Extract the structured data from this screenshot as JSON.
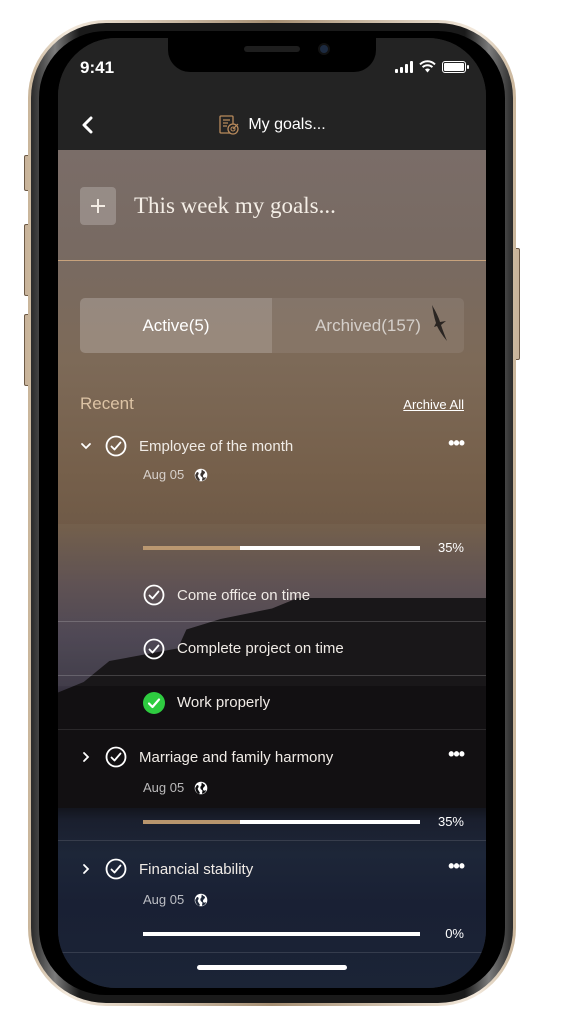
{
  "status_bar": {
    "time": "9:41"
  },
  "nav": {
    "title": "My goals...",
    "back_icon": "chevron-left-icon",
    "title_icon": "goal-checklist-icon"
  },
  "composer": {
    "placeholder_title": "This week my goals...",
    "add_icon": "plus-icon"
  },
  "tabs": [
    {
      "label": "Active(5)",
      "selected": true
    },
    {
      "label": "Archived(157)",
      "selected": false
    }
  ],
  "section": {
    "title": "Recent",
    "archive_all_label": "Archive All"
  },
  "goals": [
    {
      "title": "Employee of the month",
      "date": "Aug 05",
      "visibility_icon": "globe-icon",
      "expanded": true,
      "progress": 35,
      "progress_label": "35%",
      "subtasks": [
        {
          "label": "Come office on time",
          "done": false
        },
        {
          "label": "Complete project on time",
          "done": false
        },
        {
          "label": "Work properly",
          "done": true
        }
      ]
    },
    {
      "title": "Marriage and family harmony",
      "date": "Aug 05",
      "visibility_icon": "globe-icon",
      "expanded": false,
      "progress": 35,
      "progress_label": "35%"
    },
    {
      "title": "Financial stability",
      "date": "Aug 05",
      "visibility_icon": "globe-icon",
      "expanded": false,
      "progress": 0,
      "progress_label": "0%"
    }
  ],
  "colors": {
    "accent": "#b8956d",
    "section_title": "#dcc3a4",
    "done_green": "#2ecc40",
    "divider_gold": "#c7a27c"
  }
}
